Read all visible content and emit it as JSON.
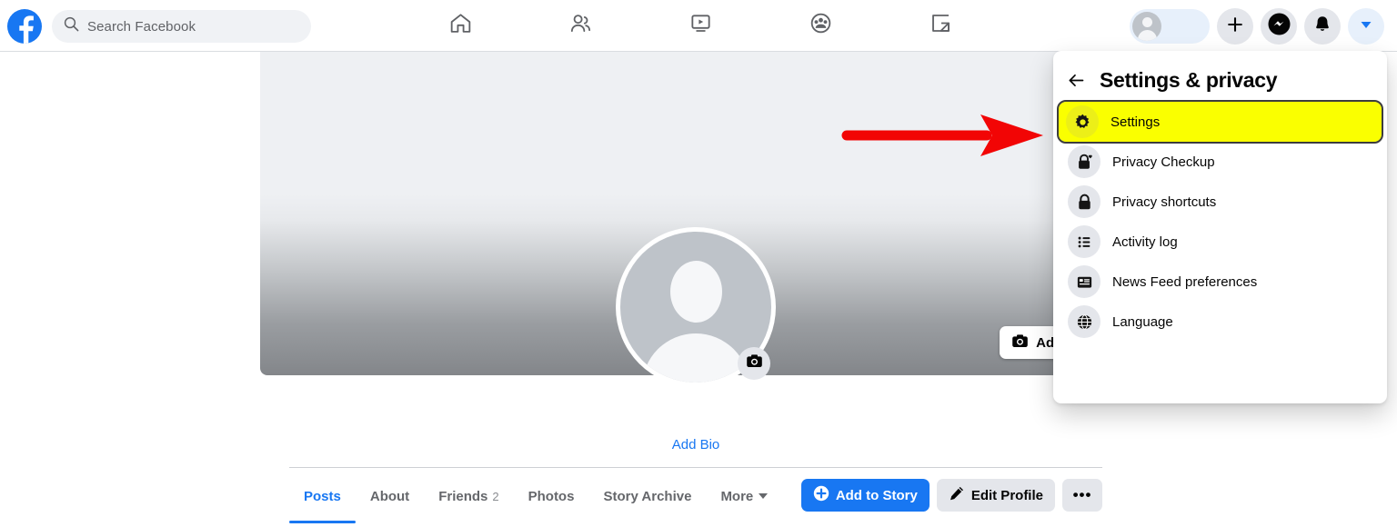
{
  "topbar": {
    "logo_icon": "facebook-logo-icon",
    "search": {
      "placeholder": "Search Facebook",
      "value": "",
      "icon": "search-icon"
    },
    "nav_tabs": [
      {
        "name": "home",
        "icon": "home-icon",
        "label": "Home"
      },
      {
        "name": "friends",
        "icon": "friends-icon",
        "label": "Friends"
      },
      {
        "name": "watch",
        "icon": "watch-video-icon",
        "label": "Watch"
      },
      {
        "name": "groups",
        "icon": "groups-icon",
        "label": "Groups"
      },
      {
        "name": "gaming",
        "icon": "gaming-icon",
        "label": "Gaming"
      }
    ],
    "right_controls": [
      {
        "name": "profile-pill",
        "icon": "avatar-icon",
        "label": ""
      },
      {
        "name": "create-button",
        "icon": "plus-icon",
        "label": ""
      },
      {
        "name": "messenger-button",
        "icon": "messenger-icon",
        "label": ""
      },
      {
        "name": "notifications-button",
        "icon": "bell-icon",
        "label": ""
      },
      {
        "name": "account-menu-button",
        "icon": "chevron-down-icon",
        "label": ""
      }
    ]
  },
  "profile": {
    "cover": {
      "add_cover_label": "Add Cover",
      "add_cover_icon": "camera-icon"
    },
    "avatar": {
      "icon": "default-avatar-icon",
      "camera_icon": "camera-icon"
    },
    "add_bio_label": "Add Bio",
    "tabs": [
      {
        "label": "Posts",
        "count": "",
        "active": true
      },
      {
        "label": "About",
        "count": "",
        "active": false
      },
      {
        "label": "Friends",
        "count": "2",
        "active": false
      },
      {
        "label": "Photos",
        "count": "",
        "active": false
      },
      {
        "label": "Story Archive",
        "count": "",
        "active": false
      },
      {
        "label": "More",
        "count": "",
        "active": false
      }
    ],
    "actions": {
      "add_to_story": "Add to Story",
      "add_to_story_icon": "plus-circle-icon",
      "edit_profile": "Edit Profile",
      "edit_profile_icon": "pencil-icon",
      "more_label": "•••"
    }
  },
  "dropdown": {
    "title": "Settings & privacy",
    "back_icon": "arrow-left-icon",
    "items": [
      {
        "label": "Settings",
        "icon": "gear-icon",
        "highlighted": true
      },
      {
        "label": "Privacy Checkup",
        "icon": "lock-heart-icon",
        "highlighted": false
      },
      {
        "label": "Privacy shortcuts",
        "icon": "lock-icon",
        "highlighted": false
      },
      {
        "label": "Activity log",
        "icon": "list-icon",
        "highlighted": false
      },
      {
        "label": "News Feed preferences",
        "icon": "news-feed-icon",
        "highlighted": false
      },
      {
        "label": "Language",
        "icon": "globe-icon",
        "highlighted": false
      }
    ]
  },
  "annotation": {
    "arrow_color": "#f20505",
    "highlight_color": "#faff00"
  },
  "colors": {
    "brand_blue": "#1877f2",
    "chrome_gray": "#e4e6eb",
    "text_primary": "#050505",
    "text_secondary": "#65676b"
  }
}
